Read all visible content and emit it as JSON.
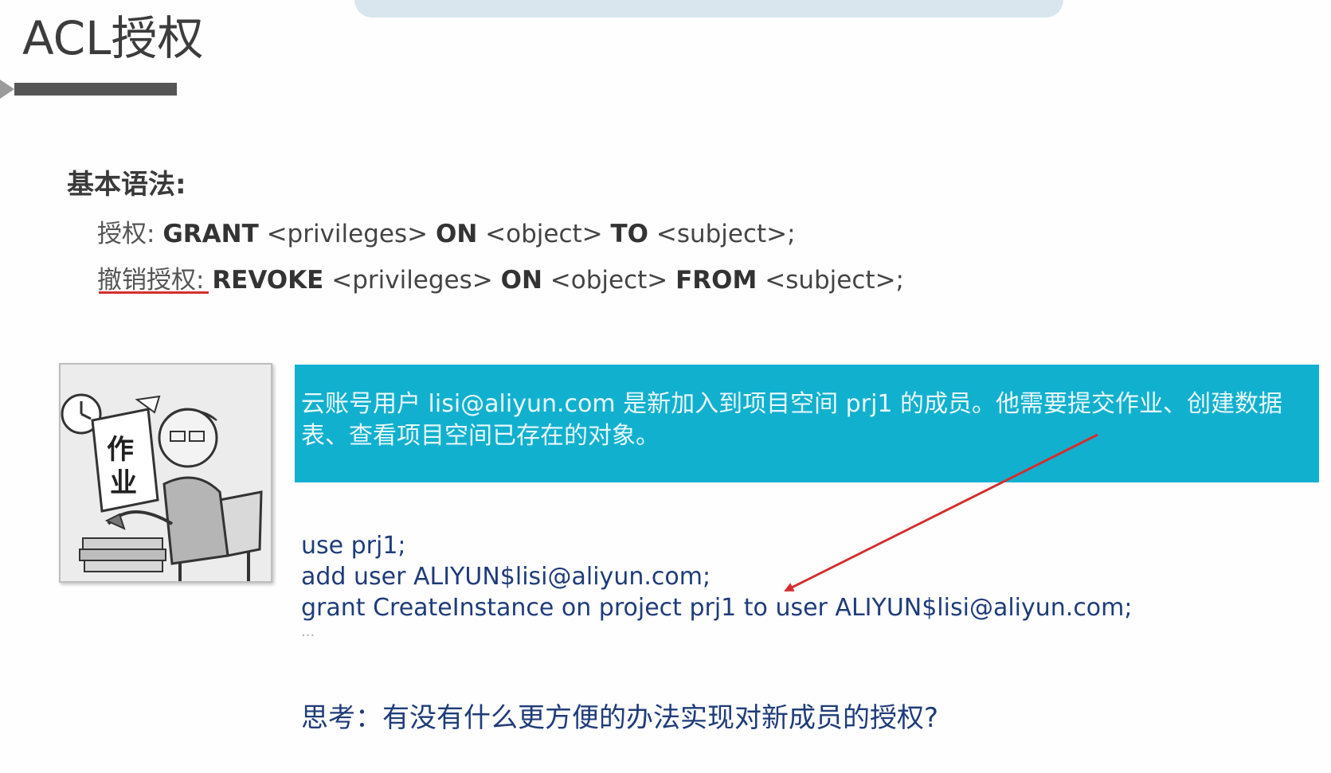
{
  "slide": {
    "title": "ACL授权"
  },
  "syntax": {
    "heading": "基本语法:",
    "grant": {
      "label": "授权:",
      "kw1": "GRANT",
      "arg1": "<privileges>",
      "kw2": "ON",
      "arg2": "<object>",
      "kw3": "TO",
      "arg3": "<subject>;"
    },
    "revoke": {
      "label": "撤销授权:",
      "kw1": "REVOKE",
      "arg1": "<privileges>",
      "kw2": "ON",
      "arg2": "<object>",
      "kw3": "FROM",
      "arg3": "<subject>;"
    }
  },
  "cartoon": {
    "sign_text_1": "作",
    "sign_text_2": "业"
  },
  "banner": {
    "text": "云账号用户 lisi@aliyun.com 是新加入到项目空间 prj1 的成员。他需要提交作业、创建数据表、查看项目空间已存在的对象。",
    "color": "#12b0cf"
  },
  "code": {
    "lines": [
      "use prj1;",
      "add user ALIYUN$lisi@aliyun.com;",
      "grant CreateInstance on project prj1 to user ALIYUN$lisi@aliyun.com;",
      "..."
    ]
  },
  "thinking": {
    "text": "思考：有没有什么更方便的办法实现对新成员的授权?"
  },
  "colors": {
    "arrow": "#d32f2f",
    "underline": "#d32f2f",
    "code_text": "#1f3c7a"
  }
}
